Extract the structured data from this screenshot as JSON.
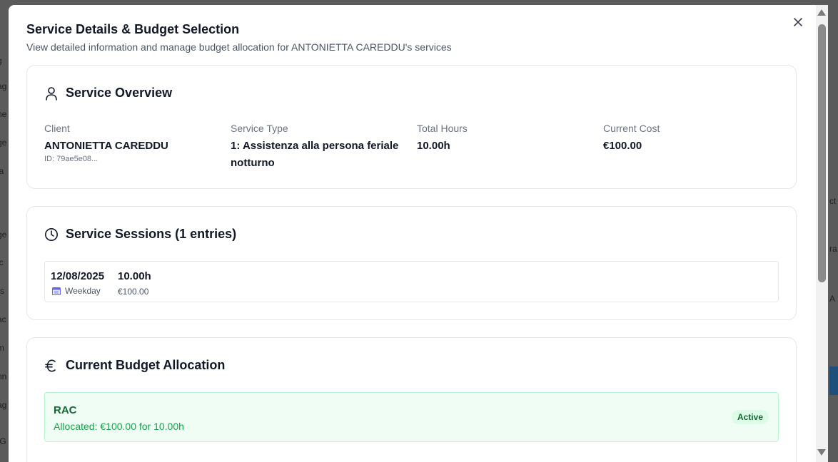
{
  "modal": {
    "title": "Service Details & Budget Selection",
    "subtitle": "View detailed information and manage budget allocation for ANTONIETTA CAREDDU's services",
    "close_icon": "x-icon"
  },
  "overview": {
    "heading": "Service Overview",
    "icon": "user-icon",
    "client_label": "Client",
    "client_value": "ANTONIETTA CAREDDU",
    "client_id": "ID: 79ae5e08...",
    "service_type_label": "Service Type",
    "service_type_value": "1: Assistenza alla persona feriale notturno",
    "total_hours_label": "Total Hours",
    "total_hours_value": "10.00h",
    "current_cost_label": "Current Cost",
    "current_cost_value": "€100.00"
  },
  "sessions": {
    "heading": "Service Sessions (1 entries)",
    "icon": "clock-icon",
    "items": [
      {
        "date": "12/08/2025",
        "hours": "10.00h",
        "day_type": "Weekday",
        "cost": "€100.00",
        "day_icon": "calendar-icon"
      }
    ]
  },
  "budget": {
    "heading": "Current Budget Allocation",
    "icon": "euro-icon",
    "name": "RAC",
    "allocation": "Allocated: €100.00 for 10.00h",
    "status": "Active"
  },
  "colors": {
    "accent_green": "#16a34a",
    "budget_bg": "#f0fdf4",
    "badge_bg": "#dcfce7"
  }
}
